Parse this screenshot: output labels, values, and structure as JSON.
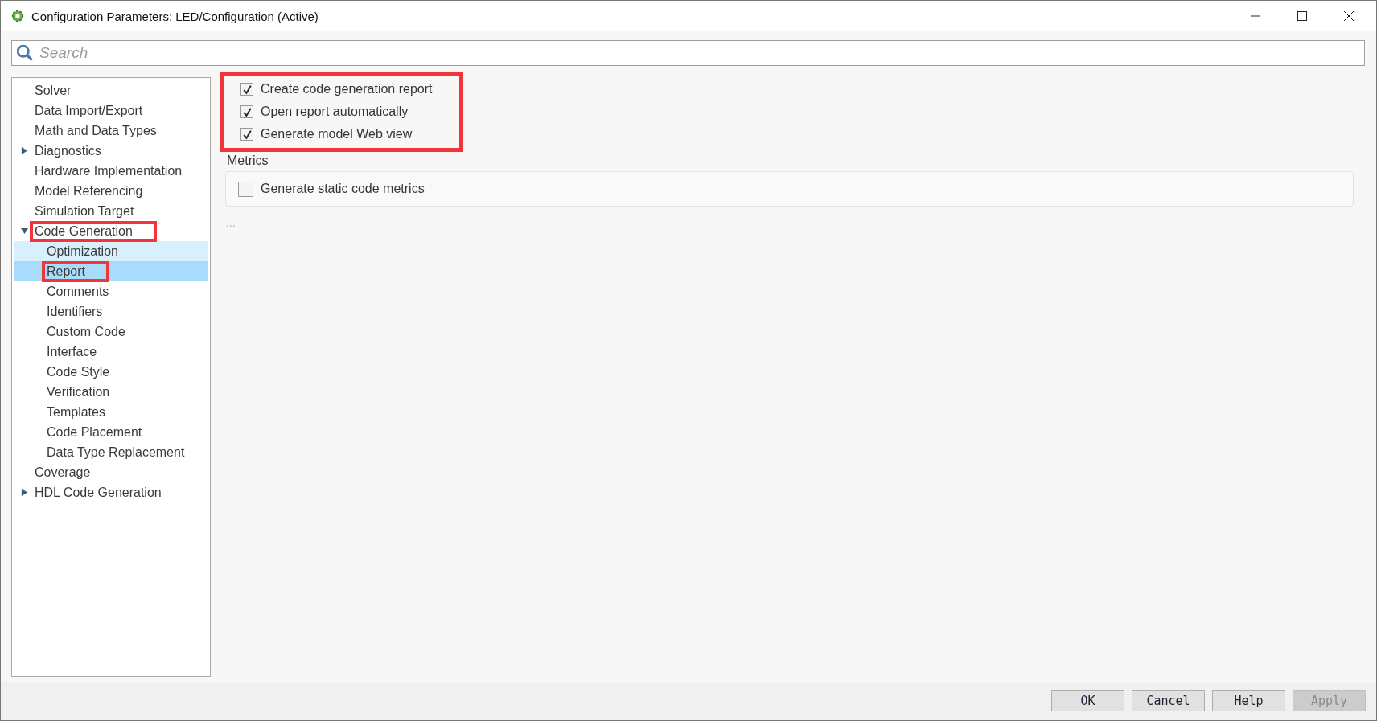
{
  "window": {
    "title": "Configuration Parameters: LED/Configuration (Active)"
  },
  "search": {
    "placeholder": "Search"
  },
  "tree": [
    {
      "label": "Solver",
      "selected": false,
      "hovered": false,
      "annotated": false
    },
    {
      "label": "Data Import/Export",
      "selected": false,
      "hovered": false,
      "annotated": false
    },
    {
      "label": "Math and Data Types",
      "selected": false,
      "hovered": false,
      "annotated": false
    },
    {
      "label": "Diagnostics",
      "selected": false,
      "hovered": false,
      "annotated": false,
      "expanded": false
    },
    {
      "label": "Hardware Implementation",
      "selected": false,
      "hovered": false,
      "annotated": false
    },
    {
      "label": "Model Referencing",
      "selected": false,
      "hovered": false,
      "annotated": false
    },
    {
      "label": "Simulation Target",
      "selected": false,
      "hovered": false,
      "annotated": false
    },
    {
      "label": "Code Generation",
      "selected": false,
      "hovered": false,
      "annotated": true,
      "expanded": true,
      "children": [
        {
          "label": "Optimization",
          "selected": false,
          "hovered": true,
          "annotated": false
        },
        {
          "label": "Report",
          "selected": true,
          "hovered": false,
          "annotated": true
        },
        {
          "label": "Comments",
          "selected": false,
          "hovered": false,
          "annotated": false
        },
        {
          "label": "Identifiers",
          "selected": false,
          "hovered": false,
          "annotated": false
        },
        {
          "label": "Custom Code",
          "selected": false,
          "hovered": false,
          "annotated": false
        },
        {
          "label": "Interface",
          "selected": false,
          "hovered": false,
          "annotated": false
        },
        {
          "label": "Code Style",
          "selected": false,
          "hovered": false,
          "annotated": false
        },
        {
          "label": "Verification",
          "selected": false,
          "hovered": false,
          "annotated": false
        },
        {
          "label": "Templates",
          "selected": false,
          "hovered": false,
          "annotated": false
        },
        {
          "label": "Code Placement",
          "selected": false,
          "hovered": false,
          "annotated": false
        },
        {
          "label": "Data Type Replacement",
          "selected": false,
          "hovered": false,
          "annotated": false
        }
      ]
    },
    {
      "label": "Coverage",
      "selected": false,
      "hovered": false,
      "annotated": false
    },
    {
      "label": "HDL Code Generation",
      "selected": false,
      "hovered": false,
      "annotated": false,
      "expanded": false
    }
  ],
  "report_options": {
    "annotated": true,
    "items": [
      {
        "label": "Create code generation report",
        "checked": true
      },
      {
        "label": "Open report automatically",
        "checked": true
      },
      {
        "label": "Generate model Web view",
        "checked": true
      }
    ]
  },
  "metrics": {
    "title": "Metrics",
    "items": [
      {
        "label": "Generate static code metrics",
        "checked": false
      }
    ]
  },
  "more": "...",
  "buttons": [
    {
      "label": "OK",
      "disabled": false
    },
    {
      "label": "Cancel",
      "disabled": false
    },
    {
      "label": "Help",
      "disabled": false
    },
    {
      "label": "Apply",
      "disabled": true
    }
  ]
}
